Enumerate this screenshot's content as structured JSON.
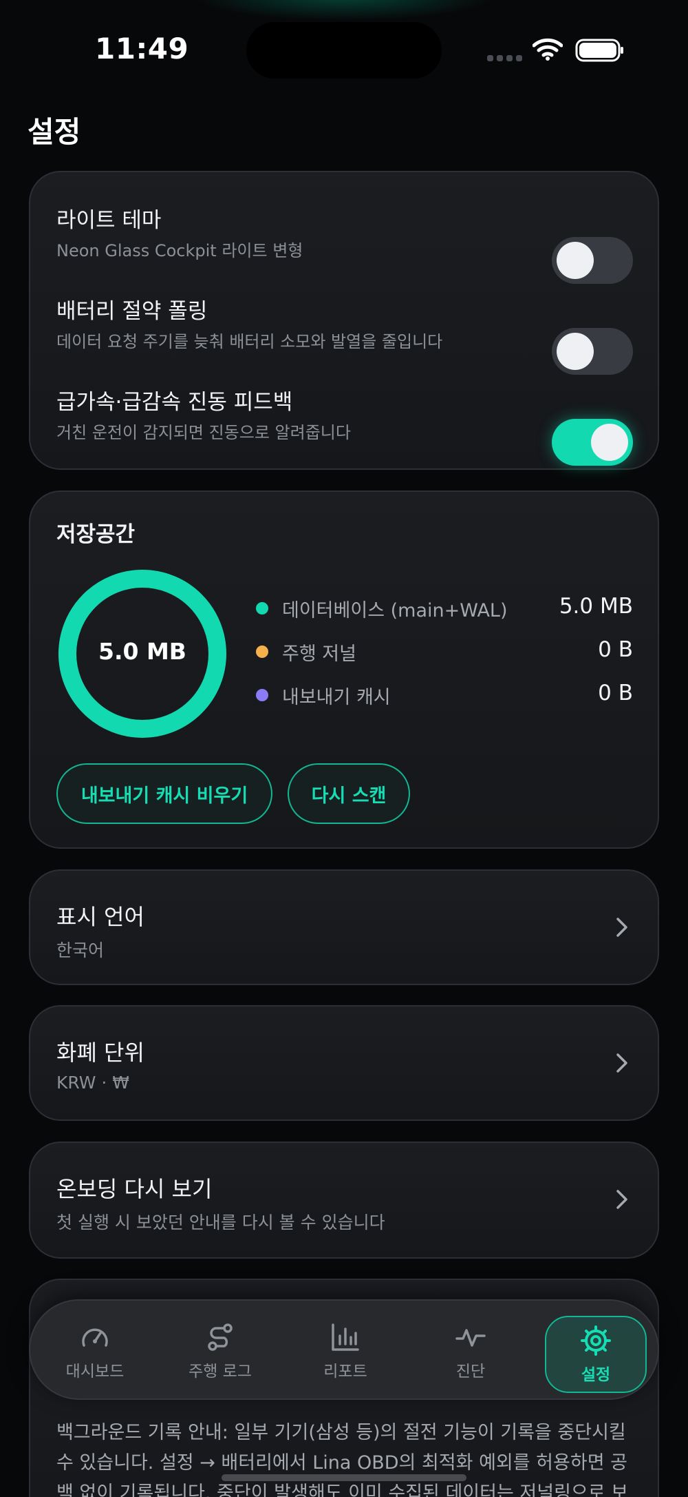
{
  "status_bar": {
    "time": "11:49"
  },
  "page_title": "설정",
  "toggles": [
    {
      "title": "라이트 테마",
      "subtitle": "Neon Glass Cockpit 라이트 변형",
      "on": false
    },
    {
      "title": "배터리 절약 폴링",
      "subtitle": "데이터 요청 주기를 늦춰 배터리 소모와 발열을 줄입니다",
      "on": false
    },
    {
      "title": "급가속·급감속 진동 피드백",
      "subtitle": "거친 운전이 감지되면 진동으로 알려줍니다",
      "on": true
    }
  ],
  "storage": {
    "title": "저장공간",
    "total": "5.0 MB",
    "items": [
      {
        "name": "데이터베이스 (main+WAL)",
        "value": "5.0 MB",
        "color": "#12D9B0"
      },
      {
        "name": "주행 저널",
        "value": "0 B",
        "color": "#F5B14C"
      },
      {
        "name": "내보내기 캐시",
        "value": "0 B",
        "color": "#8B7CF6"
      }
    ],
    "clear_button": "내보내기 캐시 비우기",
    "rescan_button": "다시 스캔"
  },
  "language": {
    "title": "표시 언어",
    "value": "한국어"
  },
  "currency": {
    "title": "화폐 단위",
    "value": "KRW · ₩"
  },
  "onboarding": {
    "title": "온보딩 다시 보기",
    "subtitle": "첫 실행 시 보았던 안내를 다시 볼 수 있습니다"
  },
  "notice": {
    "text": "백그라운드 기록 안내: 일부 기기(삼성 등)의 절전 기능이 기록을 중단시킬 수 있습니다. 설정 → 배터리에서 Lina OBD의 최적화 예외를 허용하면 공백 없이 기록됩니다. 중단이 발생해도 이미 수집된 데이터는 저널링으로 보"
  },
  "tabs": [
    {
      "label": "대시보드",
      "icon": "gauge-icon",
      "active": false
    },
    {
      "label": "주행 로그",
      "icon": "route-icon",
      "active": false
    },
    {
      "label": "리포트",
      "icon": "bar-chart-icon",
      "active": false
    },
    {
      "label": "진단",
      "icon": "pulse-icon",
      "active": false
    },
    {
      "label": "설정",
      "icon": "gear-icon",
      "active": true
    }
  ],
  "colors": {
    "accent": "#12D9B0",
    "background": "#070809",
    "card": "#1B1D21"
  }
}
